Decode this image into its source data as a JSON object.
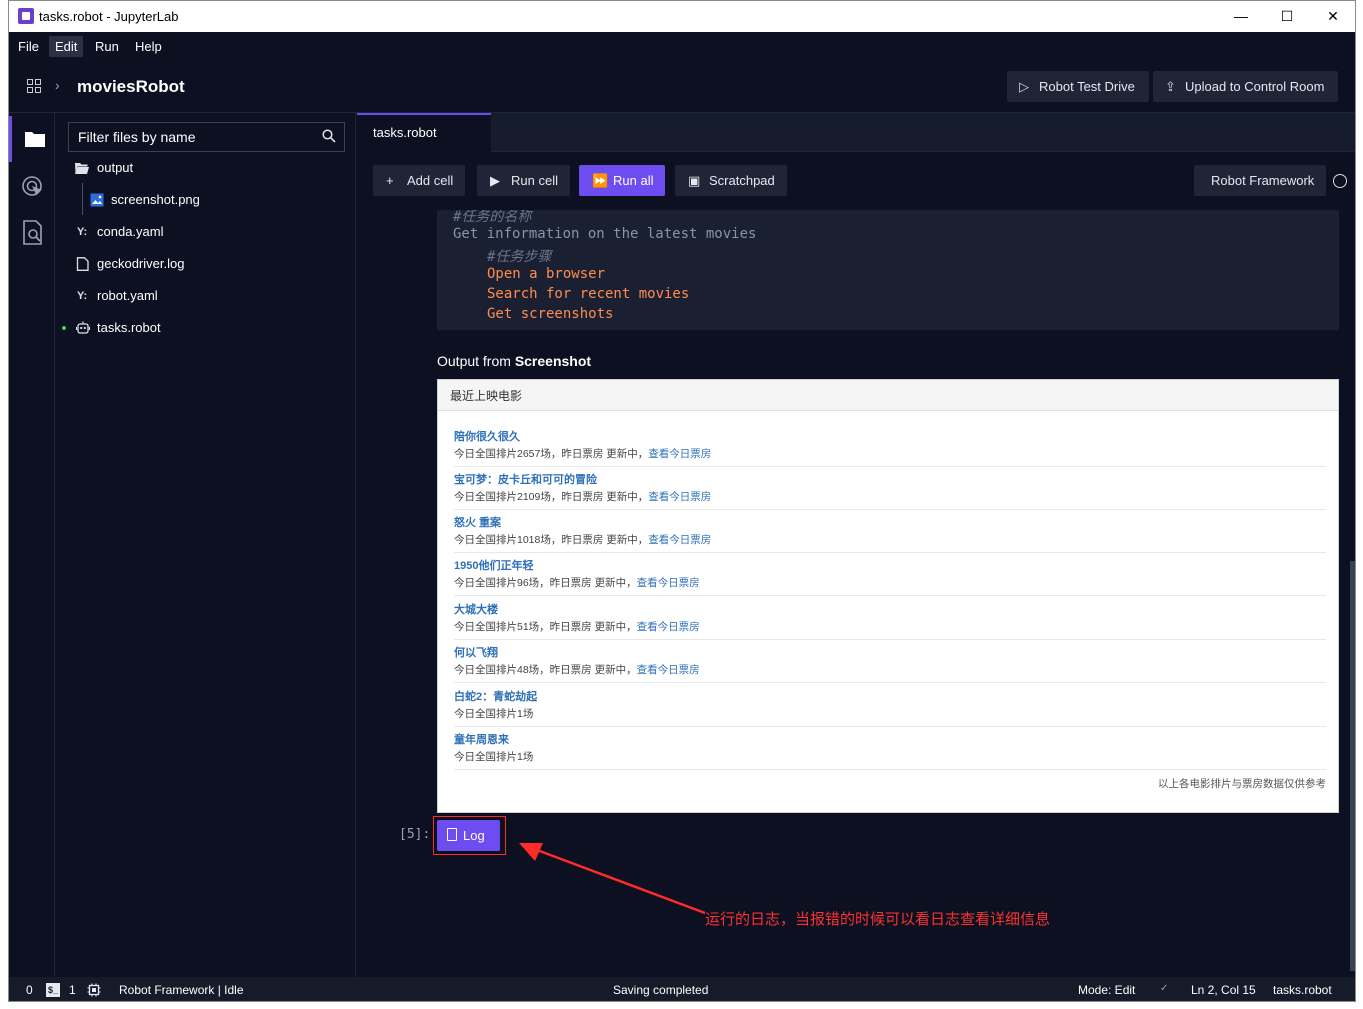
{
  "window": {
    "title": "tasks.robot - JupyterLab",
    "minimize": "—",
    "maximize": "☐",
    "close": "✕"
  },
  "menu": [
    "File",
    "Edit",
    "Run",
    "Help"
  ],
  "header": {
    "project": "moviesRobot",
    "chevron": "›",
    "test_drive_label": "Robot Test Drive",
    "upload_label": "Upload to Control Room"
  },
  "filebrowser": {
    "filter_placeholder": "Filter files by name",
    "files": [
      {
        "name": "output",
        "icon": "folder-open-icon"
      },
      {
        "name": "screenshot.png",
        "icon": "image-icon"
      },
      {
        "name": "conda.yaml",
        "icon": "yaml-icon",
        "badge": "Y:"
      },
      {
        "name": "geckodriver.log",
        "icon": "file-icon"
      },
      {
        "name": "robot.yaml",
        "icon": "yaml-icon",
        "badge": "Y:"
      },
      {
        "name": "tasks.robot",
        "icon": "robot-icon"
      }
    ]
  },
  "tab": {
    "label": "tasks.robot"
  },
  "toolbar": {
    "add_cell": "Add cell",
    "run_cell": "Run cell",
    "run_all": "Run all",
    "scratchpad": "Scratchpad",
    "kernel": "Robot Framework"
  },
  "code": {
    "lines": [
      {
        "text": "#任务的名称",
        "style": "comment",
        "indent": 0
      },
      {
        "text": "Get information on the latest movies",
        "style": "plain",
        "indent": 0
      },
      {
        "text": "#任务步骤",
        "style": "comment",
        "indent": 1
      },
      {
        "text": "Open a browser",
        "style": "kw",
        "indent": 1
      },
      {
        "text": "Search for recent movies",
        "style": "kw",
        "indent": 1
      },
      {
        "text": "Get screenshots",
        "style": "kw",
        "indent": 1
      }
    ]
  },
  "output": {
    "label_prefix": "Output from ",
    "label_bold": "Screenshot",
    "section_title": "最近上映电影",
    "movies": [
      {
        "title": "陪你很久很久",
        "detail": "今日全国排片2657场，昨日票房 更新中，",
        "link": "查看今日票房"
      },
      {
        "title": "宝可梦：皮卡丘和可可的冒险",
        "detail": "今日全国排片2109场，昨日票房 更新中，",
        "link": "查看今日票房"
      },
      {
        "title": "怒火 重案",
        "detail": "今日全国排片1018场，昨日票房 更新中，",
        "link": "查看今日票房"
      },
      {
        "title": "1950他们正年轻",
        "detail": "今日全国排片96场，昨日票房 更新中，",
        "link": "查看今日票房"
      },
      {
        "title": "大城大楼",
        "detail": "今日全国排片51场，昨日票房 更新中，",
        "link": "查看今日票房"
      },
      {
        "title": "何以飞翔",
        "detail": "今日全国排片48场，昨日票房 更新中，",
        "link": "查看今日票房"
      },
      {
        "title": "白蛇2：青蛇劫起",
        "detail": "今日全国排片1场",
        "link": ""
      },
      {
        "title": "童年周恩来",
        "detail": "今日全国排片1场",
        "link": ""
      }
    ],
    "footer": "以上各电影排片与票房数据仅供参考"
  },
  "log_cell": {
    "prompt": "[5]:",
    "button": "Log"
  },
  "annotation": "运行的日志，当报错的时候可以看日志查看详细信息",
  "statusbar": {
    "count_a": "0",
    "count_b": "1",
    "kernel": "Robot Framework | Idle",
    "saving": "Saving completed",
    "mode": "Mode: Edit",
    "position": "Ln 2, Col 15",
    "file": "tasks.robot"
  },
  "colors": {
    "background": "#0c1021",
    "accent": "#6e4df0",
    "annotation": "#ff3030",
    "keyword": "#ff8c50"
  }
}
